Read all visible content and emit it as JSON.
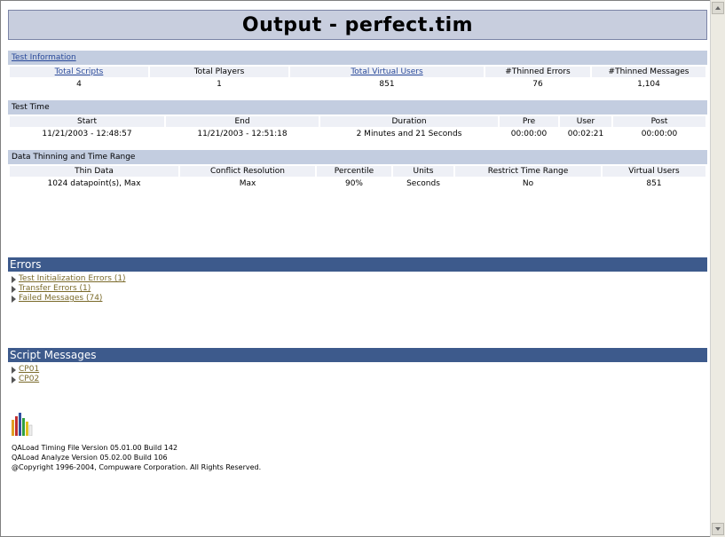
{
  "title": "Output - perfect.tim",
  "test_information": {
    "heading": "Test Information",
    "headers": [
      "Total Scripts",
      "Total Players",
      "Total Virtual Users",
      "#Thinned Errors",
      "#Thinned Messages"
    ],
    "values": [
      "4",
      "1",
      "851",
      "76",
      "1,104"
    ]
  },
  "test_time": {
    "heading": "Test Time",
    "headers": [
      "Start",
      "End",
      "Duration",
      "Pre",
      "User",
      "Post"
    ],
    "values": [
      "11/21/2003 - 12:48:57",
      "11/21/2003 - 12:51:18",
      "2 Minutes and 21 Seconds",
      "00:00:00",
      "00:02:21",
      "00:00:00"
    ]
  },
  "data_thinning": {
    "heading": "Data Thinning and Time Range",
    "headers": [
      "Thin Data",
      "Conflict Resolution",
      "Percentile",
      "Units",
      "Restrict Time Range",
      "Virtual Users"
    ],
    "values": [
      "1024 datapoint(s), Max",
      "Max",
      "90%",
      "Seconds",
      "No",
      "851"
    ]
  },
  "errors": {
    "heading": "Errors",
    "items": [
      "Test Initialization Errors (1)",
      "Transfer Errors (1)",
      "Failed Messages (74)"
    ]
  },
  "script_messages": {
    "heading": "Script Messages",
    "items": [
      "CP01",
      "CP02"
    ]
  },
  "footer": {
    "line1": "QALoad Timing File Version 05.01.00 Build 142",
    "line2": "QALoad Analyze Version 05.02.00 Build 106",
    "line3": "@Copyright 1996-2004, Compuware Corporation. All Rights Reserved."
  },
  "colors": {
    "title_bg": "#c8cede",
    "section_bg": "#c3cde0",
    "dark_bar": "#3d5a8c",
    "link": "#2a4a9a"
  }
}
